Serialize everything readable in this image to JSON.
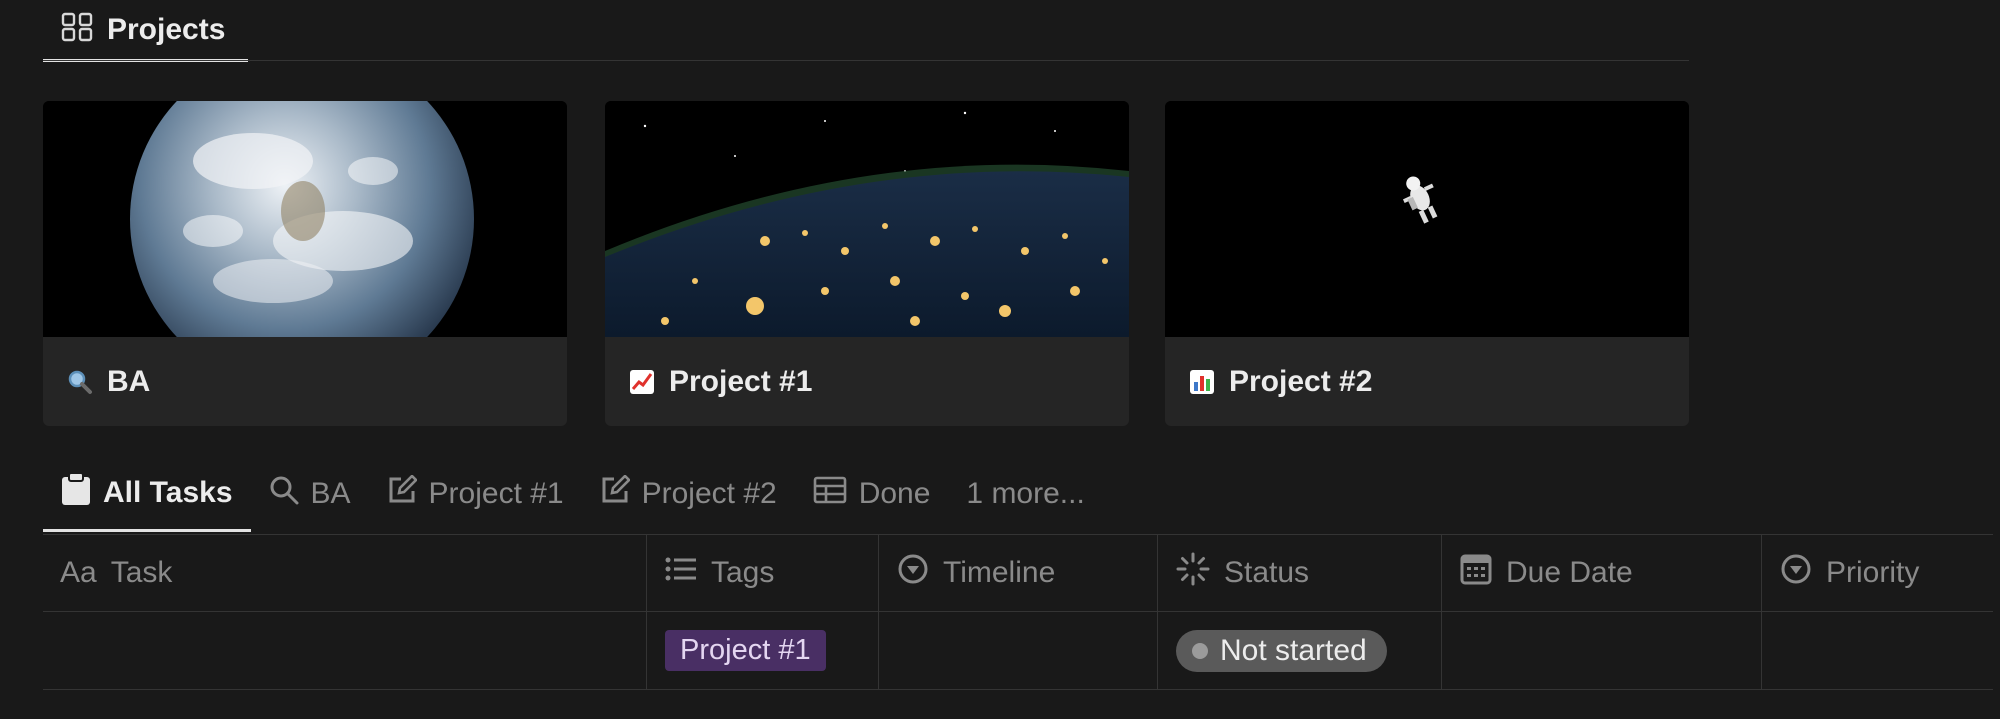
{
  "projects_tab": {
    "label": "Projects",
    "icon": "gallery-grid-icon"
  },
  "cards": [
    {
      "title": "BA",
      "emoji": "magnifying-glass-icon",
      "cover": "earth-from-space"
    },
    {
      "title": "Project #1",
      "emoji": "chart-increasing-icon",
      "cover": "earth-night-lights"
    },
    {
      "title": "Project #2",
      "emoji": "bar-chart-icon",
      "cover": "astronaut-in-space"
    }
  ],
  "views": [
    {
      "label": "All Tasks",
      "icon": "clipboard-icon",
      "active": true
    },
    {
      "label": "BA",
      "icon": "search-icon"
    },
    {
      "label": "Project #1",
      "icon": "edit-icon"
    },
    {
      "label": "Project #2",
      "icon": "edit-icon"
    },
    {
      "label": "Done",
      "icon": "table-icon"
    },
    {
      "label": "1 more..."
    }
  ],
  "table": {
    "columns": [
      {
        "label": "Task",
        "prefix": "Aa"
      },
      {
        "label": "Tags",
        "icon": "list-icon"
      },
      {
        "label": "Timeline",
        "icon": "select-circle-icon"
      },
      {
        "label": "Status",
        "icon": "status-spinner-icon"
      },
      {
        "label": "Due Date",
        "icon": "calendar-icon"
      },
      {
        "label": "Priority",
        "icon": "select-circle-icon"
      }
    ],
    "rows": [
      {
        "task": "",
        "tags": "Project #1",
        "timeline": "",
        "status": "Not started",
        "due": "",
        "priority": ""
      }
    ]
  },
  "colors": {
    "background": "#191919",
    "card": "#252525",
    "tag_purple": "#492f64",
    "status_gray": "#5a5a5a"
  }
}
